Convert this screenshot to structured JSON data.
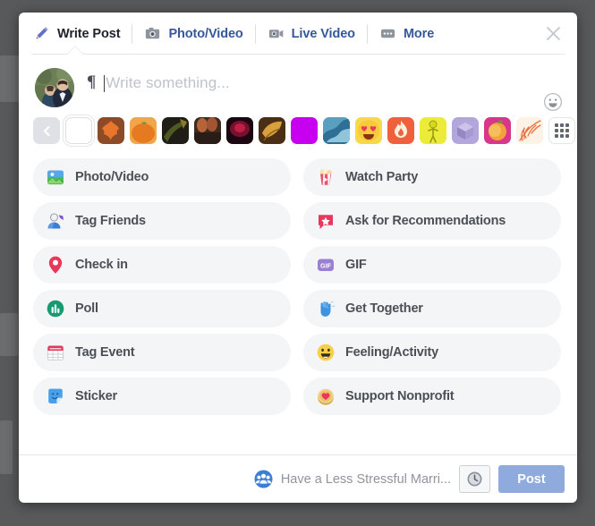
{
  "dialog": {
    "tabs": [
      {
        "label": "Write Post",
        "icon": "pencil-icon",
        "active": true
      },
      {
        "label": "Photo/Video",
        "icon": "camera-icon",
        "active": false
      },
      {
        "label": "Live Video",
        "icon": "video-camera-icon",
        "active": false
      },
      {
        "label": "More",
        "icon": "ellipsis-icon",
        "active": false
      }
    ],
    "close_icon": "close-icon",
    "tab_active_color": "#1d2129",
    "tab_link_color": "#365899"
  },
  "composer": {
    "avatar": "user-avatar-photo",
    "format_icon": "pilcrow-icon",
    "placeholder": "Write something...",
    "value": "",
    "emoji_icon": "emoji-smiley-icon"
  },
  "backgrounds": {
    "prev_icon": "chevron-left-icon",
    "more_icon": "grid-icon",
    "swatches": [
      {
        "name": "no-background",
        "type": "plain",
        "color": "#ffffff",
        "selected": true
      },
      {
        "name": "autumn-leaf",
        "type": "photo",
        "color": "#c2602c"
      },
      {
        "name": "pumpkin",
        "type": "photo",
        "color": "#e08030"
      },
      {
        "name": "dark-leaves",
        "type": "photo",
        "color": "#2b2a1c"
      },
      {
        "name": "acorns",
        "type": "photo",
        "color": "#5b4036"
      },
      {
        "name": "dark-red-glow",
        "type": "photo",
        "color": "#3d0f1c"
      },
      {
        "name": "golden-leaf",
        "type": "photo",
        "color": "#8a5a25"
      },
      {
        "name": "magenta",
        "type": "plain",
        "color": "#c800f0"
      },
      {
        "name": "blue-waves",
        "type": "photo",
        "color": "#4a8fb5"
      },
      {
        "name": "heart-eyes-emoji",
        "type": "pattern",
        "color": "#f7cf4a"
      },
      {
        "name": "fire",
        "type": "pattern",
        "color": "#f05a3c"
      },
      {
        "name": "yellow-figure",
        "type": "pattern",
        "color": "#eded3a"
      },
      {
        "name": "purple-cube",
        "type": "pattern",
        "color": "#a99bd4"
      },
      {
        "name": "peach",
        "type": "pattern",
        "color": "#d83a86"
      },
      {
        "name": "palm-leaf",
        "type": "pattern",
        "color": "#f6e4d4"
      }
    ]
  },
  "options": {
    "left": [
      {
        "label": "Photo/Video",
        "icon": "photo-video-icon"
      },
      {
        "label": "Tag Friends",
        "icon": "tag-friends-icon"
      },
      {
        "label": "Check in",
        "icon": "location-pin-icon"
      },
      {
        "label": "Poll",
        "icon": "poll-icon"
      },
      {
        "label": "Tag Event",
        "icon": "calendar-icon"
      },
      {
        "label": "Sticker",
        "icon": "sticker-icon"
      }
    ],
    "right": [
      {
        "label": "Watch Party",
        "icon": "popcorn-icon"
      },
      {
        "label": "Ask for Recommendations",
        "icon": "recommendation-bubble-icon"
      },
      {
        "label": "GIF",
        "icon": "gif-icon"
      },
      {
        "label": "Get Together",
        "icon": "waving-hand-icon"
      },
      {
        "label": "Feeling/Activity",
        "icon": "smiley-face-icon"
      },
      {
        "label": "Support Nonprofit",
        "icon": "nonprofit-coin-icon"
      }
    ]
  },
  "footer": {
    "audience_icon": "group-audience-icon",
    "audience_label": "Have a Less Stressful Marri...",
    "schedule_icon": "clock-icon",
    "post_label": "Post",
    "post_color": "#8faadc"
  }
}
